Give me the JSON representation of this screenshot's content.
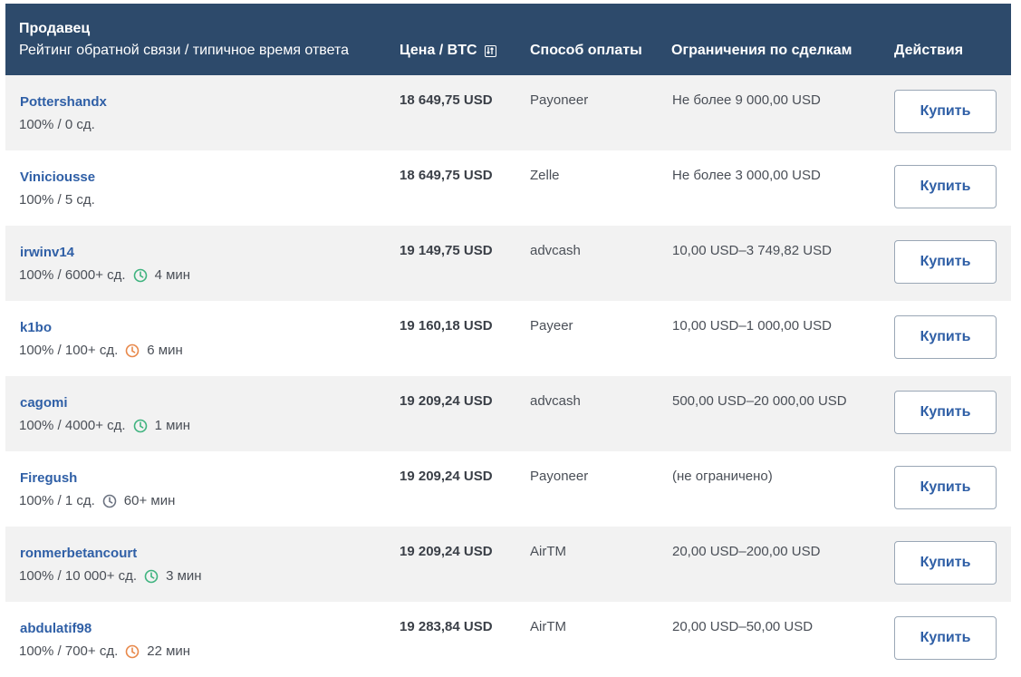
{
  "header": {
    "seller": "Продавец",
    "seller_sub": "Рейтинг обратной связи / типичное время ответа",
    "price": "Цена / BTC",
    "payment": "Способ оплаты",
    "limits": "Ограничения по сделкам",
    "actions": "Действия"
  },
  "colors": {
    "header_bg": "#2d4a6b",
    "link": "#2f5fa6",
    "clock_green": "#3fb37f",
    "clock_orange": "#e8884a",
    "clock_gray": "#6b7280"
  },
  "rows": [
    {
      "name": "Pottershandx",
      "meta": "100% / 0 сд.",
      "time": "",
      "clock": "",
      "price": "18 649,75 USD",
      "payment": "Payoneer",
      "limit": "Не более 9 000,00 USD",
      "button": "Купить"
    },
    {
      "name": "Viniciousse",
      "meta": "100% / 5 сд.",
      "time": "",
      "clock": "",
      "price": "18 649,75 USD",
      "payment": "Zelle",
      "limit": "Не более 3 000,00 USD",
      "button": "Купить"
    },
    {
      "name": "irwinv14",
      "meta": "100% / 6000+ сд.",
      "time": "4 мин",
      "clock": "green",
      "price": "19 149,75 USD",
      "payment": "advcash",
      "limit": "10,00 USD–3 749,82 USD",
      "button": "Купить"
    },
    {
      "name": "k1bo",
      "meta": "100% / 100+ сд.",
      "time": "6 мин",
      "clock": "orange",
      "price": "19 160,18 USD",
      "payment": "Payeer",
      "limit": "10,00 USD–1 000,00 USD",
      "button": "Купить"
    },
    {
      "name": "cagomi",
      "meta": "100% / 4000+ сд.",
      "time": "1 мин",
      "clock": "green",
      "price": "19 209,24 USD",
      "payment": "advcash",
      "limit": "500,00 USD–20 000,00 USD",
      "button": "Купить"
    },
    {
      "name": "Firegush",
      "meta": "100% / 1 сд.",
      "time": "60+ мин",
      "clock": "gray",
      "price": "19 209,24 USD",
      "payment": "Payoneer",
      "limit": "(не ограничено)",
      "button": "Купить"
    },
    {
      "name": "ronmerbetancourt",
      "meta": "100% / 10 000+ сд.",
      "time": "3 мин",
      "clock": "green",
      "price": "19 209,24 USD",
      "payment": "AirTM",
      "limit": "20,00 USD–200,00 USD",
      "button": "Купить"
    },
    {
      "name": "abdulatif98",
      "meta": "100% / 700+ сд.",
      "time": "22 мин",
      "clock": "orange",
      "price": "19 283,84 USD",
      "payment": "AirTM",
      "limit": "20,00 USD–50,00 USD",
      "button": "Купить"
    }
  ]
}
